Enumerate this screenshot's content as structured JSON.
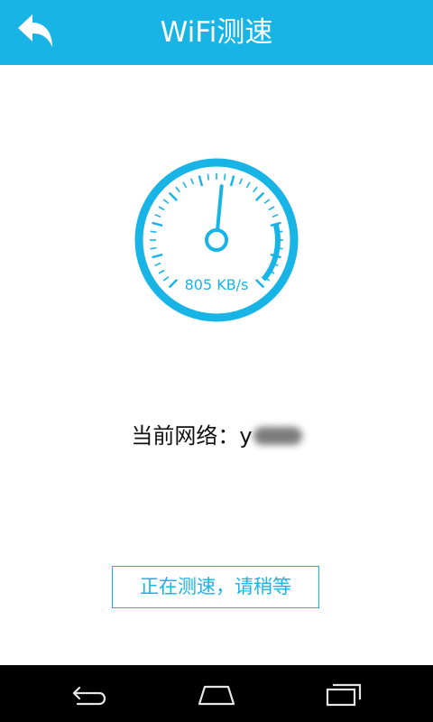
{
  "app_bar": {
    "title": "WiFi测速",
    "back_icon": "reply-arrow-icon",
    "background": "#18b4e6"
  },
  "speed_gauge": {
    "readout": "805 KB/s",
    "accent_color": "#18b4e6",
    "needle_level": 0.52
  },
  "network": {
    "label": "当前网络：",
    "name_visible": "y"
  },
  "status_button": {
    "label": "正在测速，请稍等"
  },
  "nav_bar": {
    "back_icon": "back-icon",
    "home_icon": "home-icon",
    "recents_icon": "recent-apps-icon"
  }
}
